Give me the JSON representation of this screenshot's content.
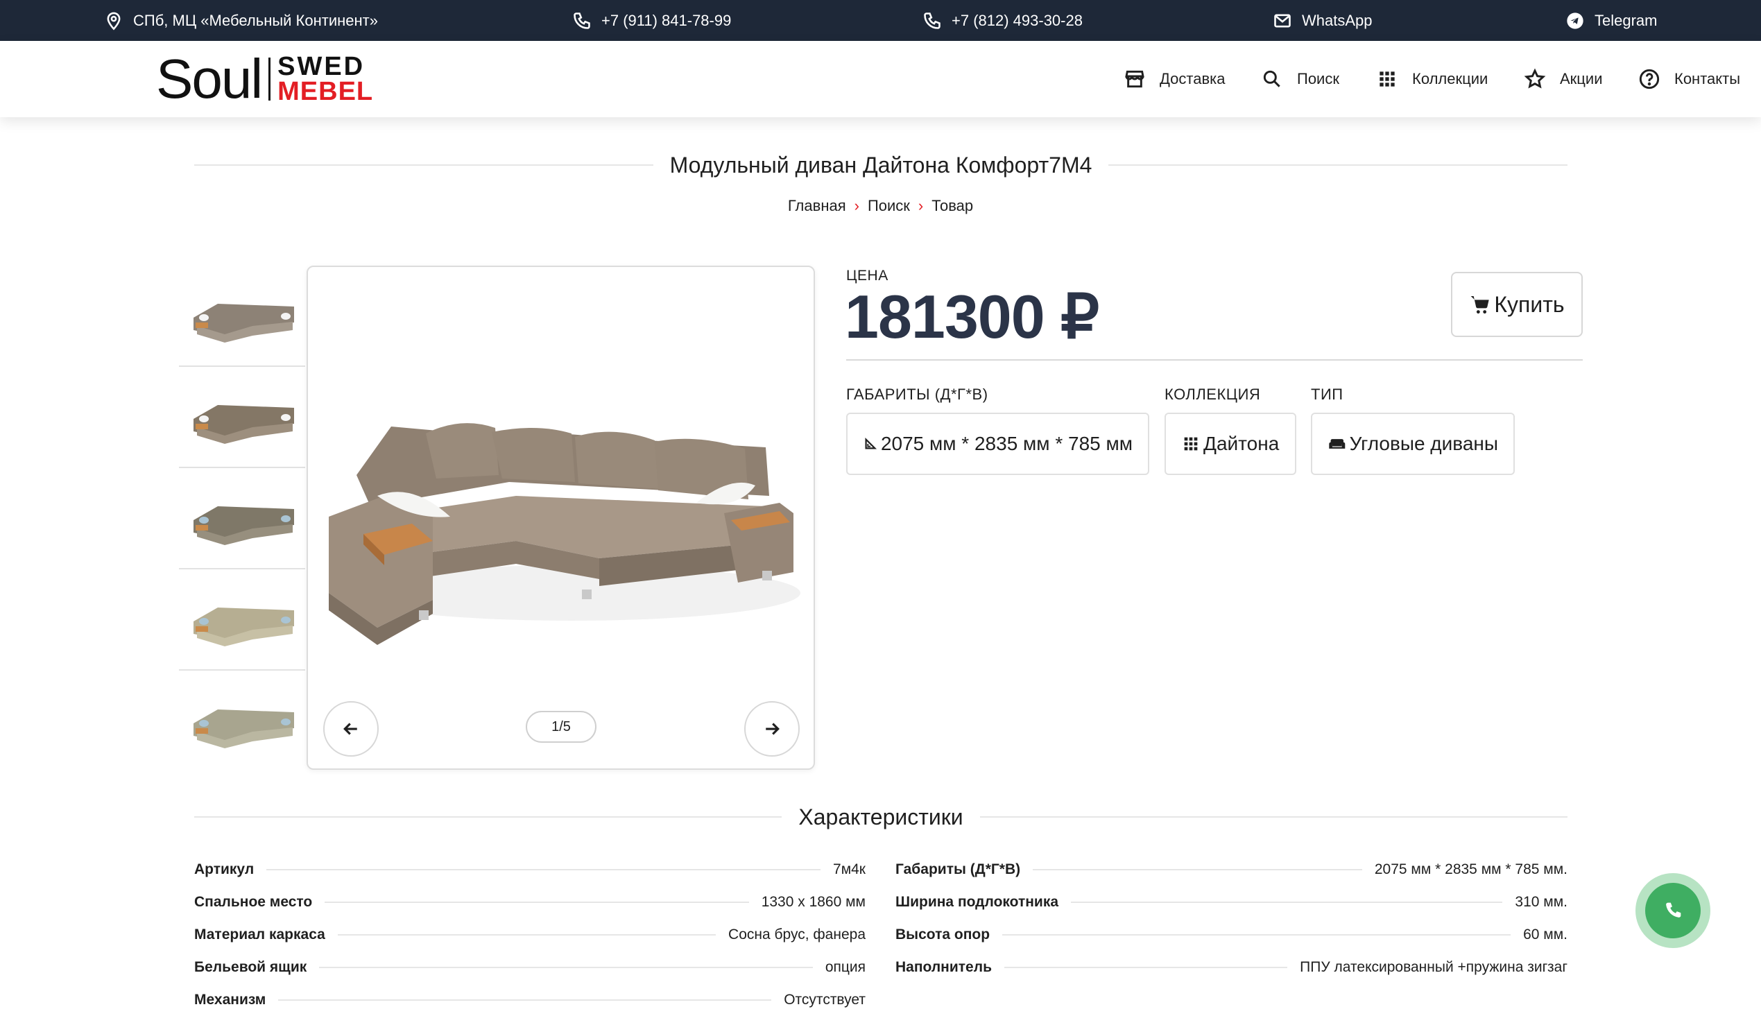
{
  "topbar": {
    "address": "СПб, МЦ «Мебельный Континент»",
    "phone1": "+7 (911) 841-78-99",
    "phone2": "+7 (812) 493-30-28",
    "whatsapp": "WhatsApp",
    "telegram": "Telegram"
  },
  "logo": {
    "soul": "Soul",
    "swed": "SWED",
    "mebel": "MEBEL"
  },
  "nav": {
    "delivery": "Доставка",
    "search": "Поиск",
    "collections": "Коллекции",
    "promos": "Акции",
    "contacts": "Контакты"
  },
  "page": {
    "title": "Модульный диван Дайтона Комфорт7М4",
    "breadcrumbs": [
      "Главная",
      "Поиск",
      "Товар"
    ]
  },
  "gallery": {
    "counter": "1/5",
    "thumb_count": 5
  },
  "product": {
    "price_label": "ЦЕНА",
    "price": "181300 ₽",
    "buy_label": "Купить",
    "dimensions_label": "ГАБАРИТЫ (Д*Г*В)",
    "dimensions_value": "2075 мм * 2835 мм * 785 мм",
    "collection_label": "КОЛЛЕКЦИЯ",
    "collection_value": "Дайтона",
    "type_label": "ТИП",
    "type_value": "Угловые диваны"
  },
  "characteristics": {
    "title": "Характеристики",
    "left": [
      {
        "key": "Артикул",
        "value": "7м4к"
      },
      {
        "key": "Спальное место",
        "value": "1330 х 1860 мм"
      },
      {
        "key": "Материал каркаса",
        "value": "Сосна брус, фанера"
      },
      {
        "key": "Бельевой ящик",
        "value": "опция"
      },
      {
        "key": "Механизм",
        "value": "Отсутствует"
      }
    ],
    "right": [
      {
        "key": "Габариты (Д*Г*В)",
        "value": "2075 мм * 2835 мм * 785 мм."
      },
      {
        "key": "Ширина подлокотника",
        "value": "310 мм."
      },
      {
        "key": "Высота опор",
        "value": "60 мм."
      },
      {
        "key": "Наполнитель",
        "value": "ППУ латексированный +пружина зигзаг"
      }
    ]
  },
  "colors": {
    "topbar_bg": "#1e2838",
    "brand_red": "#e31e24",
    "price_text": "#2b3448",
    "call_green": "#3fae62"
  }
}
